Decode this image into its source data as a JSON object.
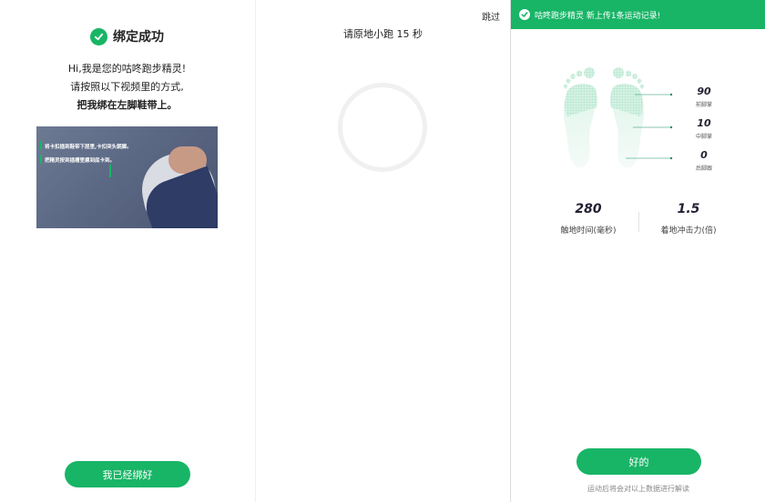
{
  "panel1": {
    "success_text": "绑定成功",
    "intro_line1": "Hi,我是您的咕咚跑步精灵!",
    "intro_line2": "请按照以下视频里的方式,",
    "intro_line3": "把我绑在左脚鞋带上。",
    "video_caption1": "将卡扣插到鞋带下层里,卡扣突头朝脚。",
    "video_caption2": "把精灵按到插槽里摁到底卡到。",
    "button_label": "我已经绑好"
  },
  "panel2": {
    "skip_label": "跳过",
    "title": "请原地小跑 15 秒"
  },
  "panel3": {
    "toast_text": "咕咚跑步精灵 新上传1条运动记录!",
    "metrics": [
      {
        "value": "90",
        "label": "前脚掌"
      },
      {
        "value": "10",
        "label": "中脚掌"
      },
      {
        "value": "0",
        "label": "后脚跟"
      }
    ],
    "stats": [
      {
        "value": "280",
        "label": "触地时间(毫秒)"
      },
      {
        "value": "1.5",
        "label": "着地冲击力(倍)"
      }
    ],
    "button_label": "好的",
    "footnote": "运动后将会对以上数据进行解读"
  },
  "colors": {
    "accent": "#18b566",
    "foot_fill": "#c8eedc",
    "foot_grid": "#7fd7ac"
  }
}
